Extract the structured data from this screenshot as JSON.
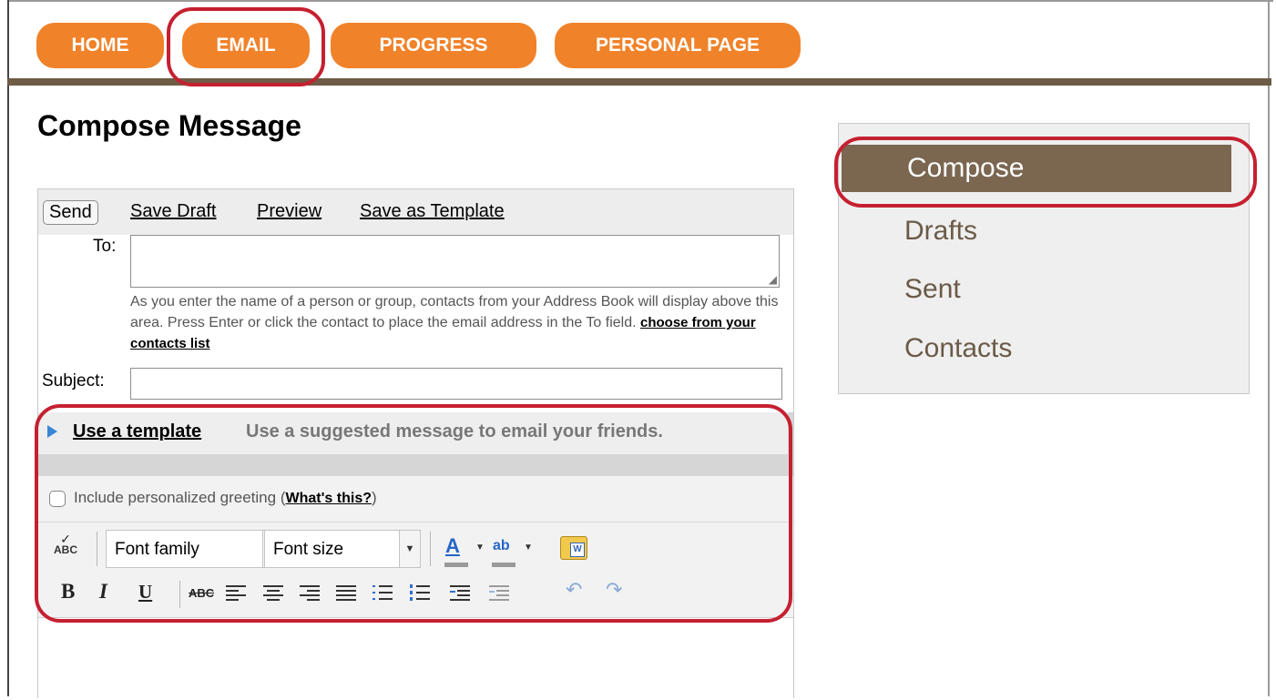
{
  "nav": {
    "tabs": [
      {
        "label": "HOME"
      },
      {
        "label": "EMAIL"
      },
      {
        "label": "PROGRESS"
      },
      {
        "label": "PERSONAL PAGE"
      }
    ],
    "active": "EMAIL"
  },
  "page": {
    "title": "Compose Message"
  },
  "actions": {
    "send": "Send",
    "save_draft": "Save Draft",
    "preview": "Preview",
    "save_as_template": "Save as Template"
  },
  "form": {
    "to_label": "To:",
    "to_value": "",
    "help_text": "As you enter the name of a person or group, contacts from your Address Book will display above this area. Press Enter or click the contact to place the email address in the To field.",
    "help_link": "choose from your contacts list",
    "subject_label": "Subject:",
    "subject_value": ""
  },
  "template": {
    "link": "Use a template",
    "description": "Use a suggested message to email your friends."
  },
  "greeting": {
    "label": "Include personalized greeting",
    "open_paren": "(",
    "link": "What's this?",
    "close_paren": ")",
    "checked": false
  },
  "toolbar": {
    "font_family": "Font family",
    "font_size": "Font size",
    "spell_label": "ABC",
    "bold": "B",
    "italic": "I",
    "underline": "U",
    "strike": "ABC",
    "font_color": "A",
    "highlight": "ab",
    "paste_word": "W"
  },
  "sidebar": {
    "items": [
      {
        "label": "Compose"
      },
      {
        "label": "Drafts"
      },
      {
        "label": "Sent"
      },
      {
        "label": "Contacts"
      }
    ],
    "active": "Compose"
  },
  "colors": {
    "tab": "#f0822a",
    "nav_rule": "#6e5c46",
    "sidebar_active": "#7b6650",
    "sidebar_text": "#6b5a47",
    "annotation": "#c52030"
  }
}
